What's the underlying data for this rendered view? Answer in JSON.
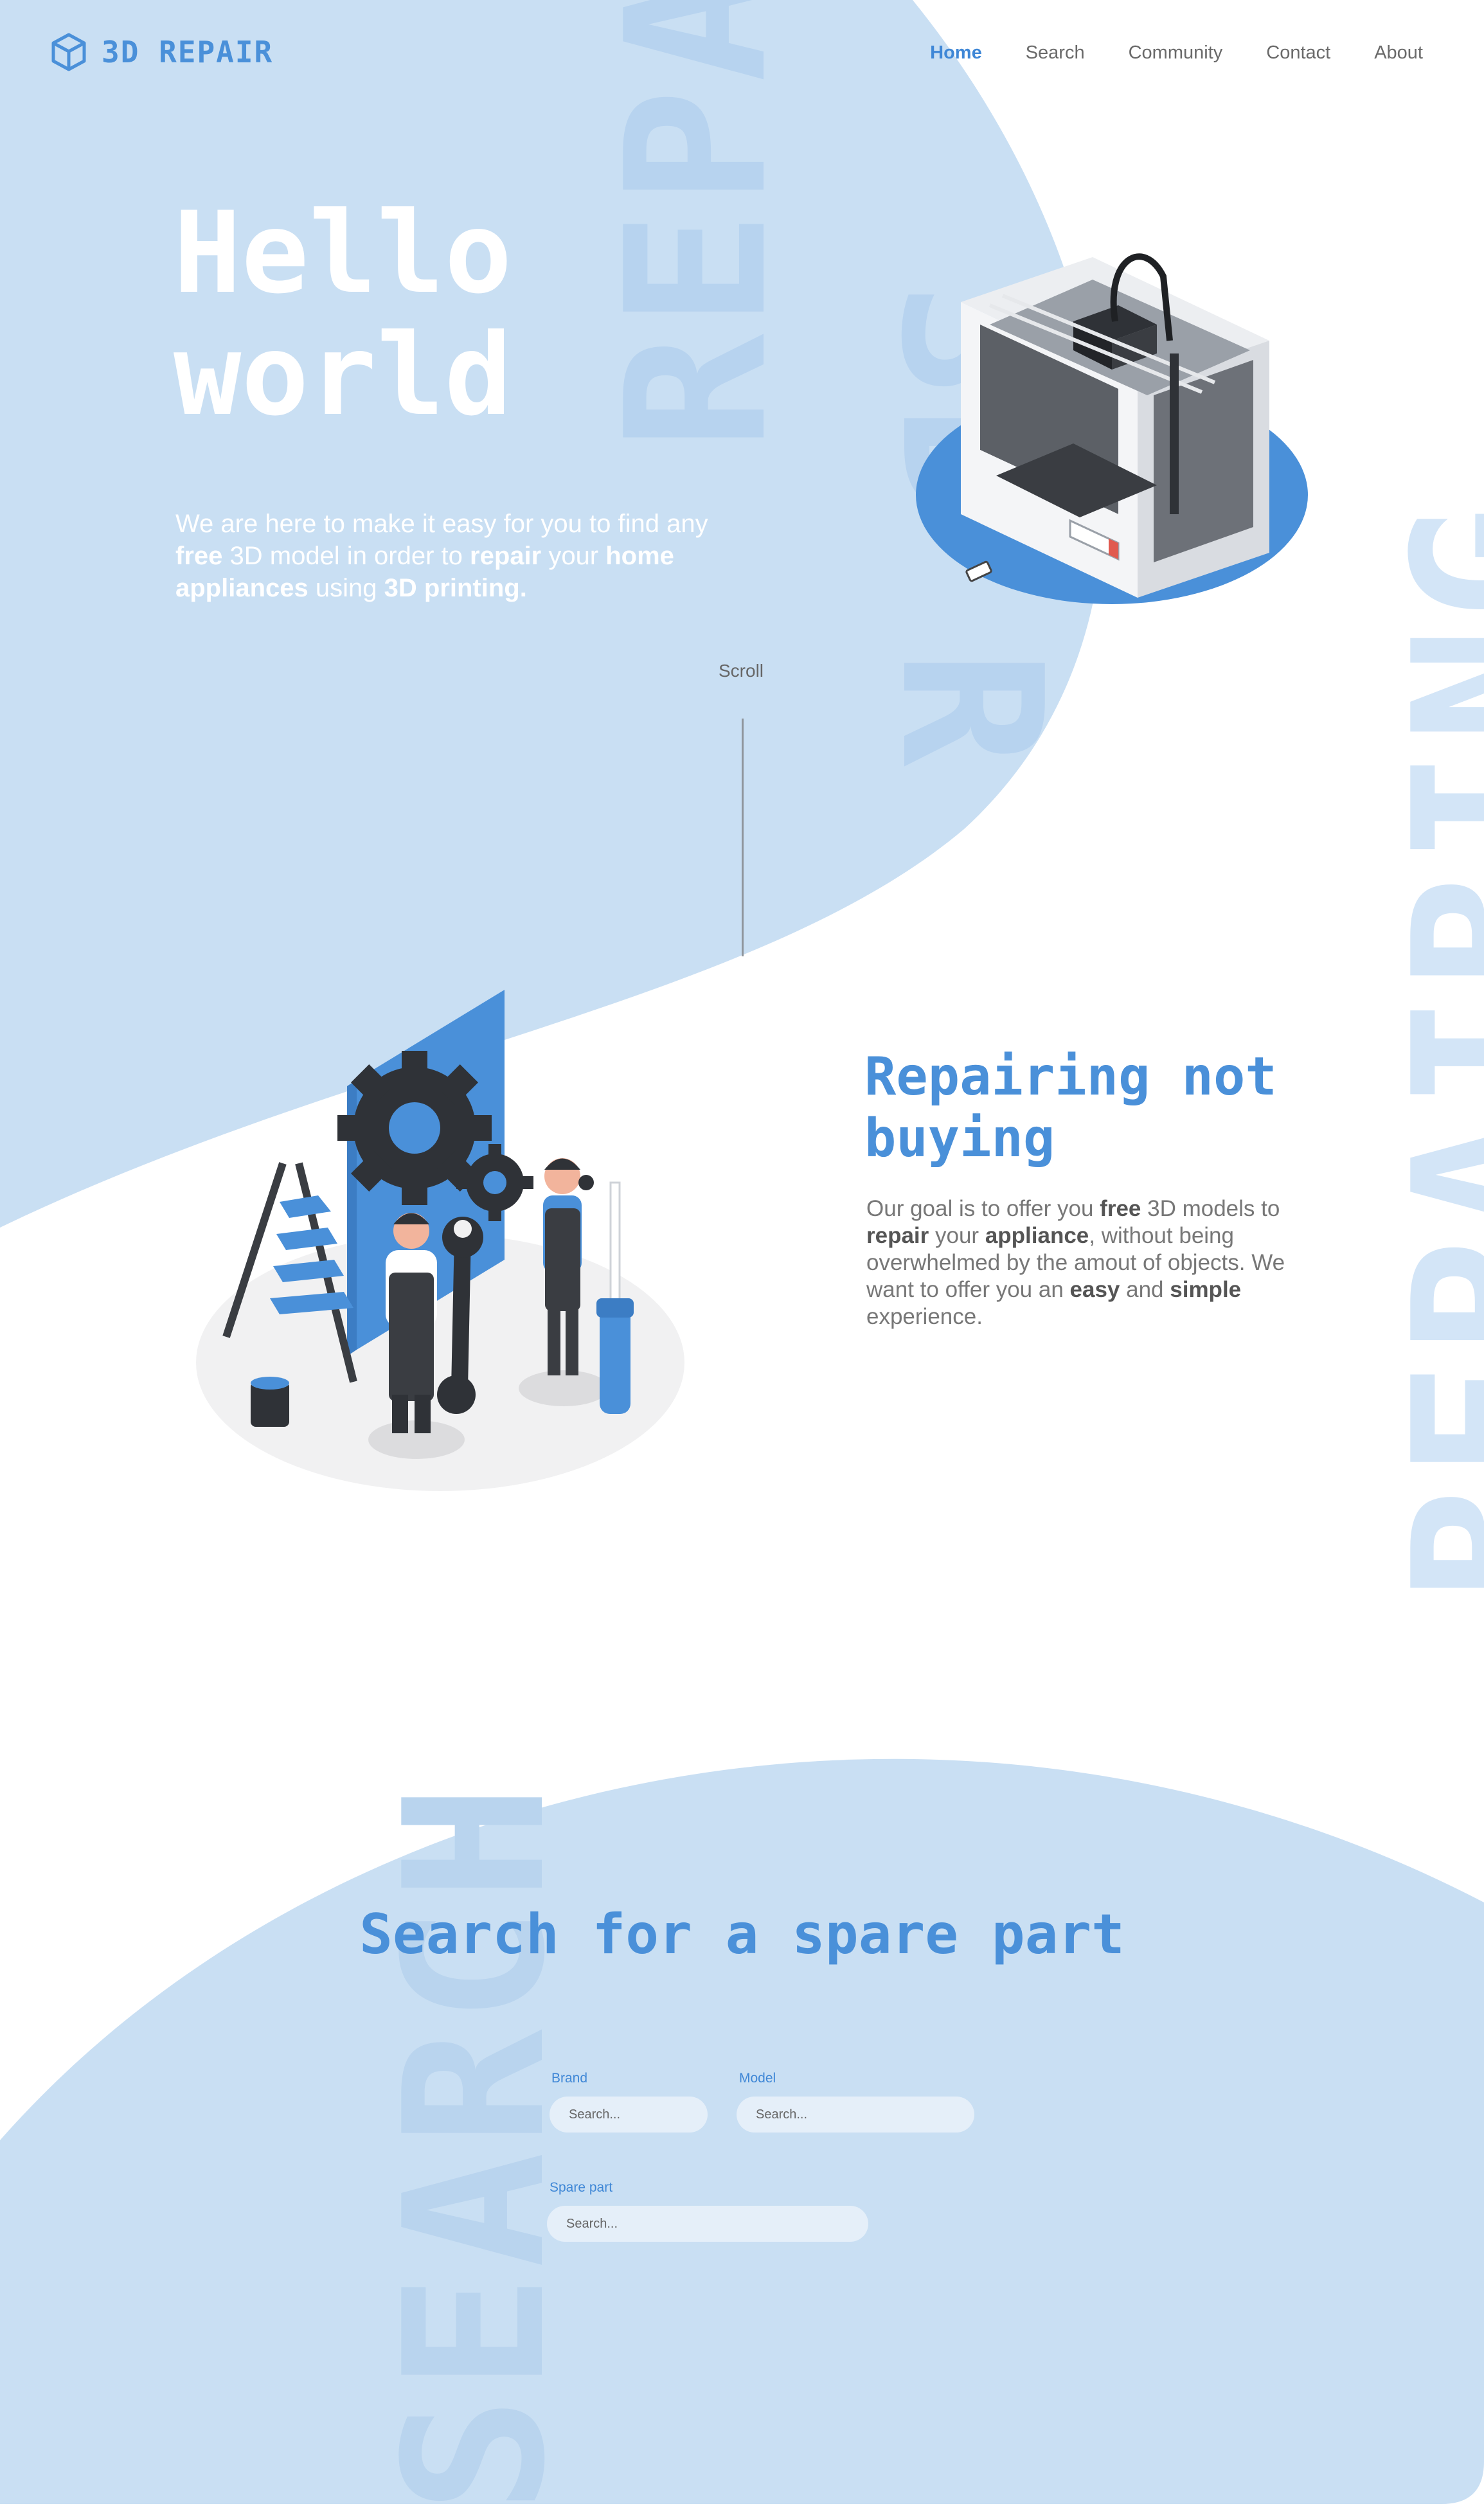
{
  "brand": {
    "name": "3D REPAIR",
    "icon": "cube-icon",
    "accent": "#4a90d9",
    "light_blue": "#c9dff3"
  },
  "nav": {
    "items": [
      {
        "label": "Home",
        "active": true
      },
      {
        "label": "Search",
        "active": false
      },
      {
        "label": "Community",
        "active": false
      },
      {
        "label": "Contact",
        "active": false
      },
      {
        "label": "About",
        "active": false
      }
    ]
  },
  "hero": {
    "title_line1": "Hello",
    "title_line2": "world",
    "copy": {
      "t1": "We are here to make it easy for you to find any ",
      "b1": "free",
      "t2": " 3D model in order to ",
      "b2": "repair",
      "t3": " your ",
      "b3": "home appliances",
      "t4": " using ",
      "b4": "3D printing."
    },
    "scroll_label": "Scroll",
    "watermark_1": "REPA",
    "watermark_2": "3D R"
  },
  "repairing": {
    "title_line1": "Repairing not",
    "title_line2": "buying",
    "copy": {
      "t1": "Our goal is to offer you ",
      "b1": "free",
      "t2": " 3D models to ",
      "b2": "repair",
      "t3": " your ",
      "b3": "appliance",
      "t4": ", without being overwhelmed by the amout of objects. We want to offer you an ",
      "b4": "easy",
      "t5": " and ",
      "b5": "simple",
      "t6": " experience."
    },
    "watermark": "REPAIRING"
  },
  "search": {
    "title": "Search for a spare part",
    "watermark": "SEARCH",
    "fields": {
      "brand": {
        "label": "Brand",
        "placeholder": "Search..."
      },
      "model": {
        "label": "Model",
        "placeholder": "Search..."
      },
      "spare_part": {
        "label": "Spare part",
        "placeholder": "Search..."
      }
    }
  }
}
